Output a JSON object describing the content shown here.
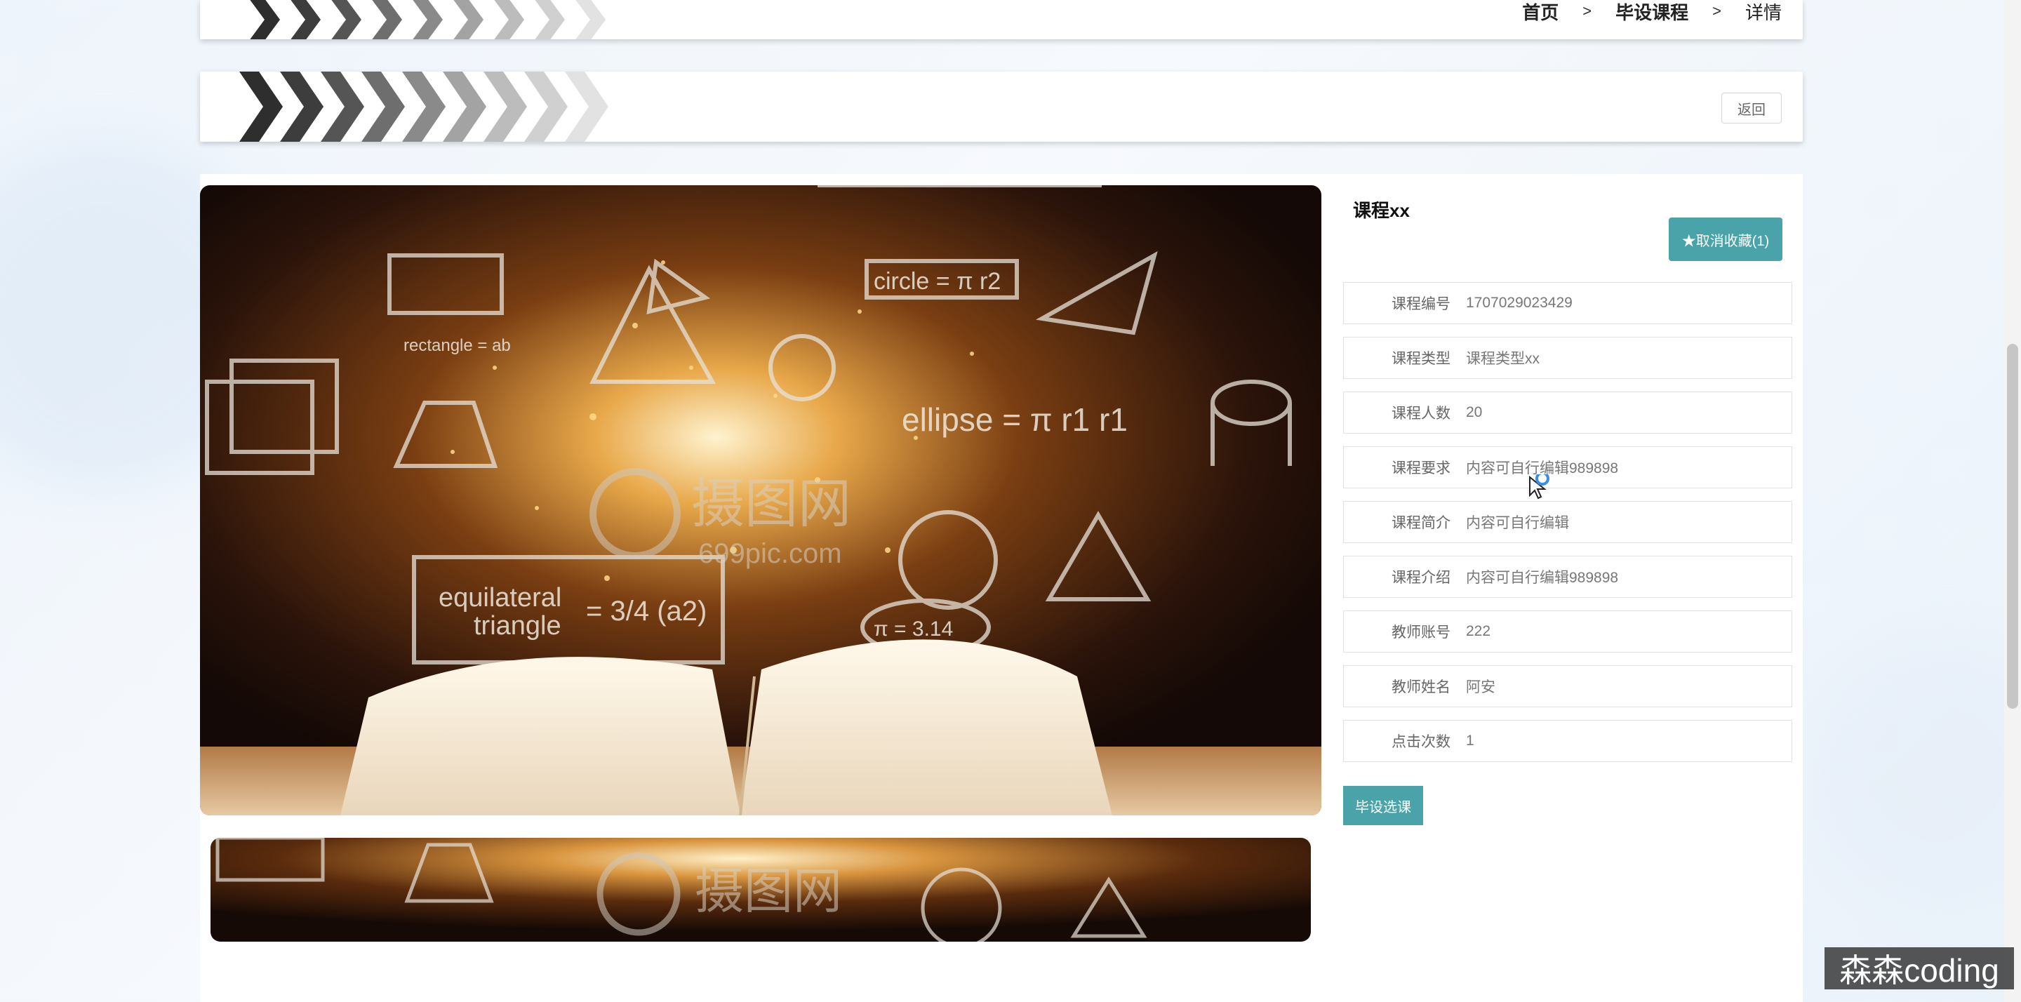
{
  "breadcrumb": {
    "home": "首页",
    "sep": ">",
    "section": "毕设课程",
    "current": "详情"
  },
  "back_label": "返回",
  "course": {
    "title": "课程xx",
    "favorite_label": "★取消收藏(1)",
    "fields": [
      {
        "label": "课程编号",
        "value": "1707029023429"
      },
      {
        "label": "课程类型",
        "value": "课程类型xx"
      },
      {
        "label": "课程人数",
        "value": "20"
      },
      {
        "label": "课程要求",
        "value": "内容可自行编辑989898"
      },
      {
        "label": "课程简介",
        "value": "内容可自行编辑"
      },
      {
        "label": "课程介绍",
        "value": "内容可自行编辑989898"
      },
      {
        "label": "教师账号",
        "value": "222"
      },
      {
        "label": "教师姓名",
        "value": "阿安"
      },
      {
        "label": "点击次数",
        "value": "1"
      }
    ],
    "select_label": "毕设选课"
  },
  "hero_texts": {
    "circle": "circle = π r2",
    "rectangle": "rectangle = ab",
    "ellipse": "ellipse = π r1 r1",
    "equilateral": "equilateral",
    "triangle": "triangle",
    "formula": "= 3/4 (a2)",
    "pi": "π = 3.14",
    "wm_cn": "摄图网",
    "wm_en": "699pic.com"
  },
  "watermark": "森森coding",
  "colors": {
    "accent": "#4aa3a8"
  }
}
